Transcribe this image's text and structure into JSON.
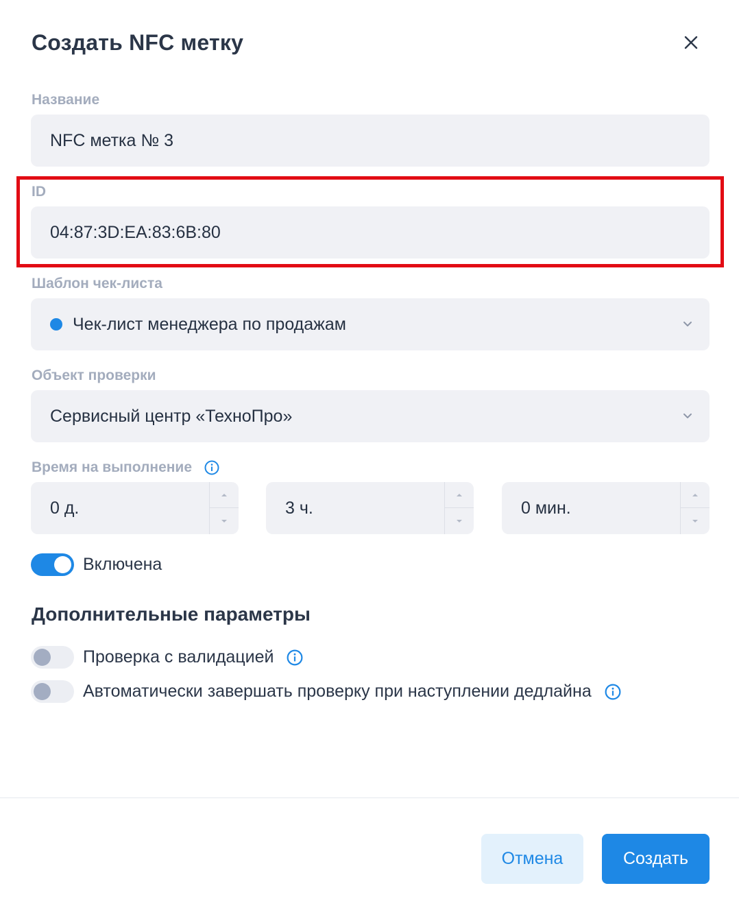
{
  "dialog": {
    "title": "Создать NFC метку",
    "fields": {
      "name": {
        "label": "Название",
        "value": "NFC метка № 3"
      },
      "id": {
        "label": "ID",
        "value": "04:87:3D:EA:83:6B:80"
      },
      "template": {
        "label": "Шаблон чек-листа",
        "value": "Чек-лист менеджера по продажам",
        "dot_color": "#1e88e5"
      },
      "object": {
        "label": "Объект проверки",
        "value": "Сервисный центр «ТехноПро»"
      },
      "time": {
        "label": "Время на выполнение",
        "days": "0 д.",
        "hours": "3 ч.",
        "minutes": "0 мин."
      }
    },
    "enabled_toggle": {
      "label": "Включена",
      "on": true
    },
    "additional": {
      "title": "Дополнительные параметры",
      "validation": {
        "label": "Проверка с валидацией",
        "on": false
      },
      "auto_complete": {
        "label": "Автоматически завершать проверку при наступлении дедлайна",
        "on": false
      }
    },
    "buttons": {
      "cancel": "Отмена",
      "create": "Создать"
    }
  },
  "colors": {
    "accent": "#1e88e5",
    "highlight_border": "#e20c14",
    "field_bg": "#f0f1f5",
    "label": "#a3acbd"
  },
  "icons": [
    "close-icon",
    "chevron-down-icon",
    "info-icon",
    "arrow-up-icon",
    "arrow-down-icon"
  ]
}
